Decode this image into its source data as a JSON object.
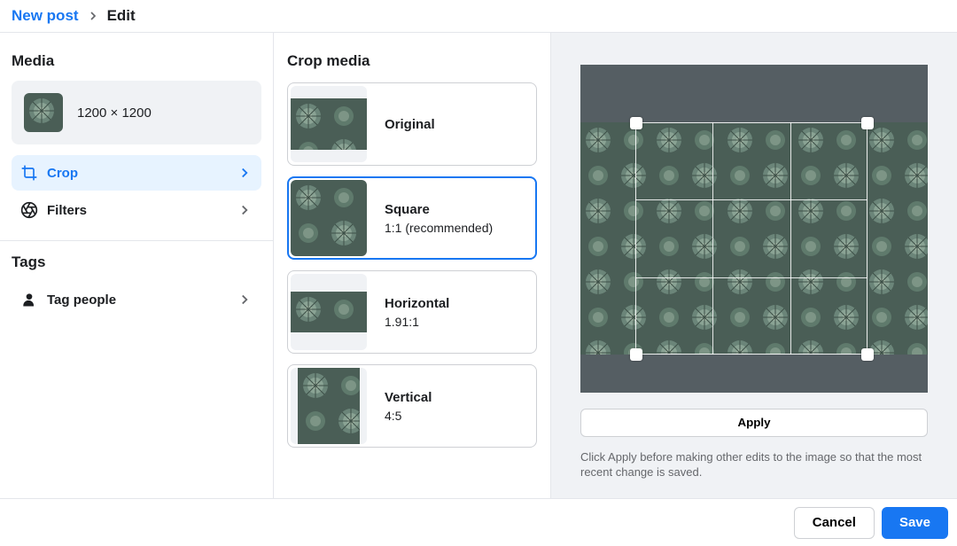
{
  "breadcrumb": {
    "parent": "New post",
    "current": "Edit"
  },
  "sidebar": {
    "media_heading": "Media",
    "media_dimensions": "1200 × 1200",
    "crop_label": "Crop",
    "filters_label": "Filters",
    "tags_heading": "Tags",
    "tag_people_label": "Tag people"
  },
  "crop_panel": {
    "heading": "Crop media",
    "options": [
      {
        "title": "Original",
        "sub": "",
        "thumb_w": 86,
        "thumb_h": 58,
        "selected": false
      },
      {
        "title": "Square",
        "sub": "1:1 (recommended)",
        "thumb_w": 86,
        "thumb_h": 86,
        "selected": true
      },
      {
        "title": "Horizontal",
        "sub": "1.91:1",
        "thumb_w": 86,
        "thumb_h": 46,
        "selected": false
      },
      {
        "title": "Vertical",
        "sub": "4:5",
        "thumb_w": 70,
        "thumb_h": 86,
        "selected": false
      }
    ]
  },
  "preview": {
    "apply_label": "Apply",
    "hint": "Click Apply before making other edits to the image so that the most recent change is saved."
  },
  "footer": {
    "cancel": "Cancel",
    "save": "Save"
  }
}
